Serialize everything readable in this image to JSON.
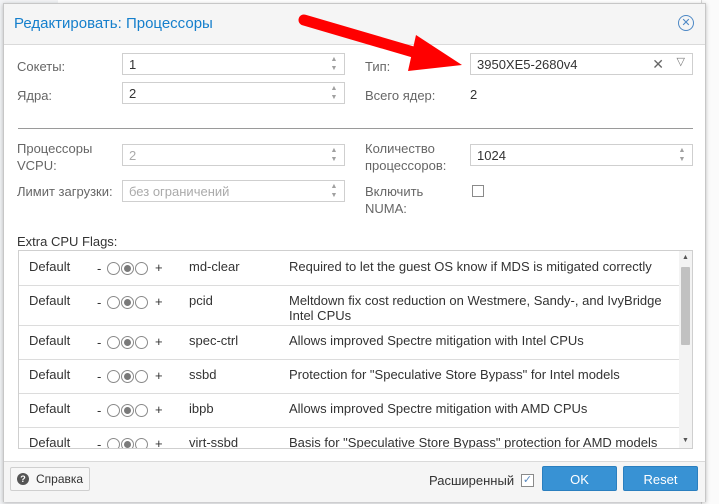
{
  "dialog": {
    "title": "Редактировать: Процессоры",
    "sockets": {
      "label": "Сокеты:",
      "value": "1"
    },
    "cores": {
      "label": "Ядра:",
      "value": "2"
    },
    "type": {
      "label": "Тип:",
      "value": "3950XE5-2680v4"
    },
    "total_cores": {
      "label": "Всего ядер:",
      "value": "2"
    },
    "vcpu": {
      "label": "Процессоры VCPU:",
      "value": "2"
    },
    "cpu_units": {
      "label": "Количество процессоров:",
      "value": "1024"
    },
    "cpu_limit": {
      "label": "Лимит загрузки:",
      "value": "без ограничений"
    },
    "numa": {
      "label": "Включить NUMA:",
      "checked": false
    },
    "flags_label": "Extra CPU Flags:"
  },
  "flags": [
    {
      "state": "Default",
      "minus": "-",
      "plus": "+",
      "name": "md-clear",
      "description": "Required to let the guest OS know if MDS is mitigated correctly"
    },
    {
      "state": "Default",
      "minus": "-",
      "plus": "+",
      "name": "pcid",
      "description": "Meltdown fix cost reduction on Westmere, Sandy-, and IvyBridge Intel CPUs"
    },
    {
      "state": "Default",
      "minus": "-",
      "plus": "+",
      "name": "spec-ctrl",
      "description": "Allows improved Spectre mitigation with Intel CPUs"
    },
    {
      "state": "Default",
      "minus": "-",
      "plus": "+",
      "name": "ssbd",
      "description": "Protection for \"Speculative Store Bypass\" for Intel models"
    },
    {
      "state": "Default",
      "minus": "-",
      "plus": "+",
      "name": "ibpb",
      "description": "Allows improved Spectre mitigation with AMD CPUs"
    },
    {
      "state": "Default",
      "minus": "-",
      "plus": "+",
      "name": "virt-ssbd",
      "description": "Basis for \"Speculative Store Bypass\" protection for AMD models"
    }
  ],
  "footer": {
    "help_label": "Справка",
    "advanced_label": "Расширенный",
    "advanced_checked": true,
    "ok_label": "OK",
    "reset_label": "Reset"
  },
  "colors": {
    "accent": "#157fcc",
    "button": "#3892d4",
    "annotation_arrow": "#ff0000"
  }
}
